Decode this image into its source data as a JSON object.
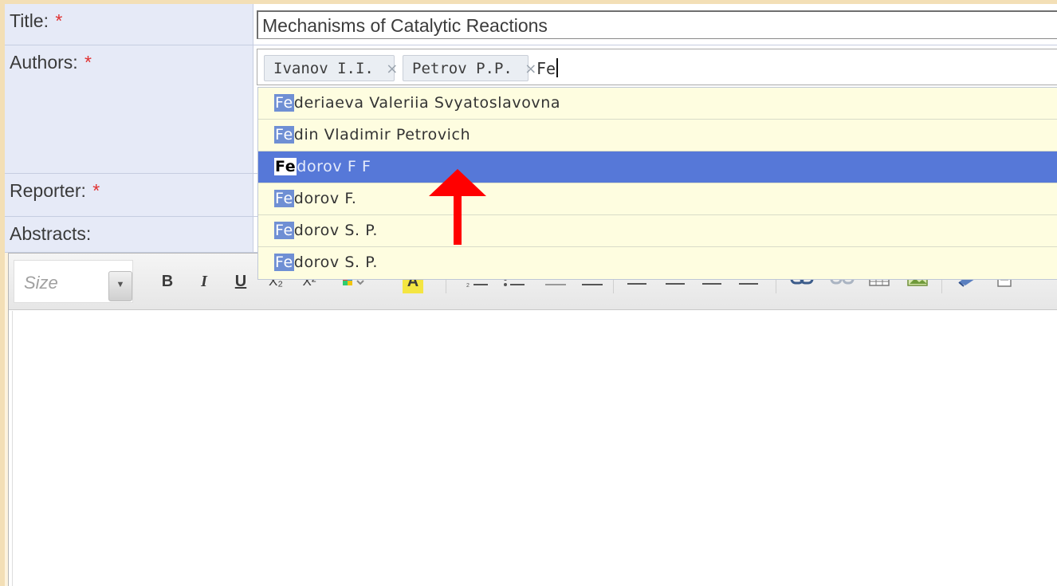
{
  "form": {
    "title_label": "Title:",
    "authors_label": "Authors:",
    "reporter_label": "Reporter:",
    "abstracts_label": "Abstracts:",
    "required_mark": "*",
    "title_value": "Mechanisms of Catalytic Reactions"
  },
  "authors": {
    "tokens": [
      {
        "label": "Ivanov I.I.",
        "remove": "×"
      },
      {
        "label": "Petrov P.P.",
        "remove": "×"
      }
    ],
    "typed": "Fe"
  },
  "suggestions": [
    {
      "match": "Fe",
      "rest": "deriaeva Valeriia Svyatoslavovna",
      "active": false
    },
    {
      "match": "Fe",
      "rest": "din Vladimir Petrovich",
      "active": false
    },
    {
      "match": "Fe",
      "rest": "dorov F F",
      "active": true
    },
    {
      "match": "Fe",
      "rest": "dorov F.",
      "active": false
    },
    {
      "match": "Fe",
      "rest": "dorov S. P.",
      "active": false
    },
    {
      "match": "Fe",
      "rest": "dorov S. P.",
      "active": false
    }
  ],
  "editor": {
    "size_placeholder": "Size",
    "buttons": {
      "bold": "B",
      "italic": "I",
      "underline": "U",
      "subscript": "X₂",
      "superscript": "X²",
      "text_color": "A"
    },
    "body_text": ""
  },
  "colors": {
    "active_row": "#5678d8",
    "match_highlight": "#6f8fd4",
    "required": "#e03131",
    "arrow": "#ff0000"
  }
}
